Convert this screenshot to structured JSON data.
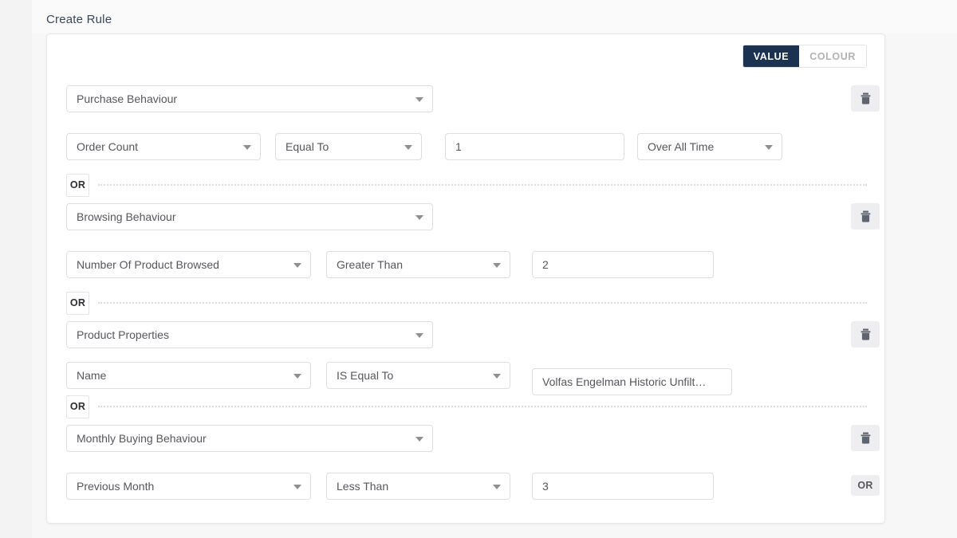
{
  "page": {
    "title": "Create Rule"
  },
  "toggle": {
    "value_label": "VALUE",
    "colour_label": "COLOUR",
    "active": "VALUE",
    "active_bg": "#1b3350",
    "inactive_fg": "#b2b2b6"
  },
  "icons": {
    "trash": "trash-icon",
    "caret": "chevron-down-icon"
  },
  "groups": [
    {
      "category_label": "Purchase Behaviour",
      "has_delete": true,
      "separator_label": "OR",
      "fields": [
        {
          "name": "field-select",
          "label": "Order Count"
        },
        {
          "name": "operator-select",
          "label": "Equal To"
        },
        {
          "name": "value-input",
          "label": "1"
        },
        {
          "name": "timeframe-select",
          "label": "Over All Time"
        }
      ]
    },
    {
      "category_label": "Browsing Behaviour",
      "has_delete": true,
      "separator_label": "OR",
      "fields": [
        {
          "name": "field-select",
          "label": "Number Of Product Browsed"
        },
        {
          "name": "operator-select",
          "label": "Greater Than"
        },
        {
          "name": "value-input",
          "label": "2"
        }
      ]
    },
    {
      "category_label": "Product Properties",
      "has_delete": true,
      "separator_label": "OR",
      "fields": [
        {
          "name": "field-select",
          "label": "Name"
        },
        {
          "name": "operator-select",
          "label": "IS Equal To"
        },
        {
          "name": "value-input",
          "label": "Volfas Engelman Historic Unfilt…"
        }
      ]
    },
    {
      "category_label": "Monthly Buying Behaviour",
      "has_delete": true,
      "separator_label": null,
      "fields": [
        {
          "name": "field-select",
          "label": "Previous Month"
        },
        {
          "name": "operator-select",
          "label": "Less Than"
        },
        {
          "name": "value-input",
          "label": "3"
        }
      ]
    }
  ],
  "add_condition": {
    "label": "OR"
  }
}
